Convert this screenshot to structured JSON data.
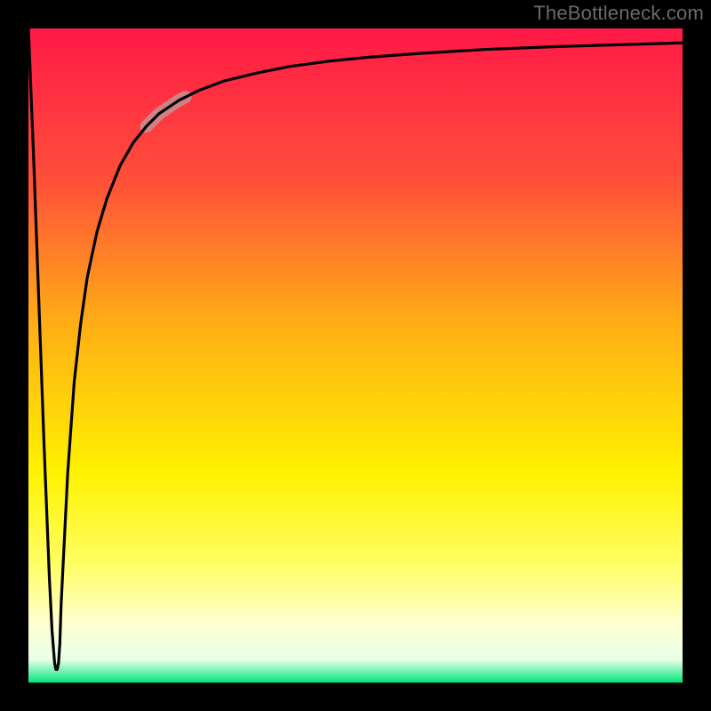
{
  "watermark": "TheBottleneck.com",
  "chart_data": {
    "type": "line",
    "title": "",
    "xlabel": "",
    "ylabel": "",
    "xlim": [
      0,
      100
    ],
    "ylim": [
      0,
      100
    ],
    "grid": false,
    "background_gradient": {
      "stops": [
        {
          "offset": 0.0,
          "color": "#ff1947"
        },
        {
          "offset": 0.23,
          "color": "#ff4e3a"
        },
        {
          "offset": 0.45,
          "color": "#ffad16"
        },
        {
          "offset": 0.68,
          "color": "#fff200"
        },
        {
          "offset": 0.82,
          "color": "#ffff66"
        },
        {
          "offset": 0.91,
          "color": "#ffffd2"
        },
        {
          "offset": 0.965,
          "color": "#e9ffe9"
        },
        {
          "offset": 1.0,
          "color": "#00e57a"
        }
      ]
    },
    "series": [
      {
        "name": "bottleneck-curve",
        "color": "#000000",
        "x": [
          0.0,
          0.8,
          1.6,
          2.4,
          3.2,
          3.6,
          4.0,
          4.2,
          4.4,
          4.6,
          4.8,
          5.0,
          5.5,
          6.0,
          7.0,
          8.0,
          9.0,
          10.5,
          12.0,
          14.0,
          16.0,
          18.0,
          20.0,
          23.0,
          26.0,
          30.0,
          35.0,
          40.0,
          46.0,
          52.0,
          60.0,
          70.0,
          80.0,
          90.0,
          100.0
        ],
        "y": [
          100.0,
          80.0,
          58.0,
          36.0,
          16.0,
          8.0,
          3.0,
          2.0,
          2.0,
          3.0,
          6.0,
          12.0,
          22.0,
          32.0,
          46.0,
          55.0,
          62.0,
          69.0,
          74.0,
          79.0,
          82.5,
          85.0,
          87.0,
          89.0,
          90.5,
          92.0,
          93.2,
          94.2,
          95.0,
          95.6,
          96.2,
          96.8,
          97.2,
          97.5,
          97.8
        ]
      }
    ],
    "highlight_segment": {
      "on_series": "bottleneck-curve",
      "x_start": 18.0,
      "x_end": 24.0,
      "color": "#c98b8e",
      "opacity": 0.9,
      "width": 14
    },
    "axes": {
      "frame_color": "#000000",
      "frame_width": 32
    }
  }
}
